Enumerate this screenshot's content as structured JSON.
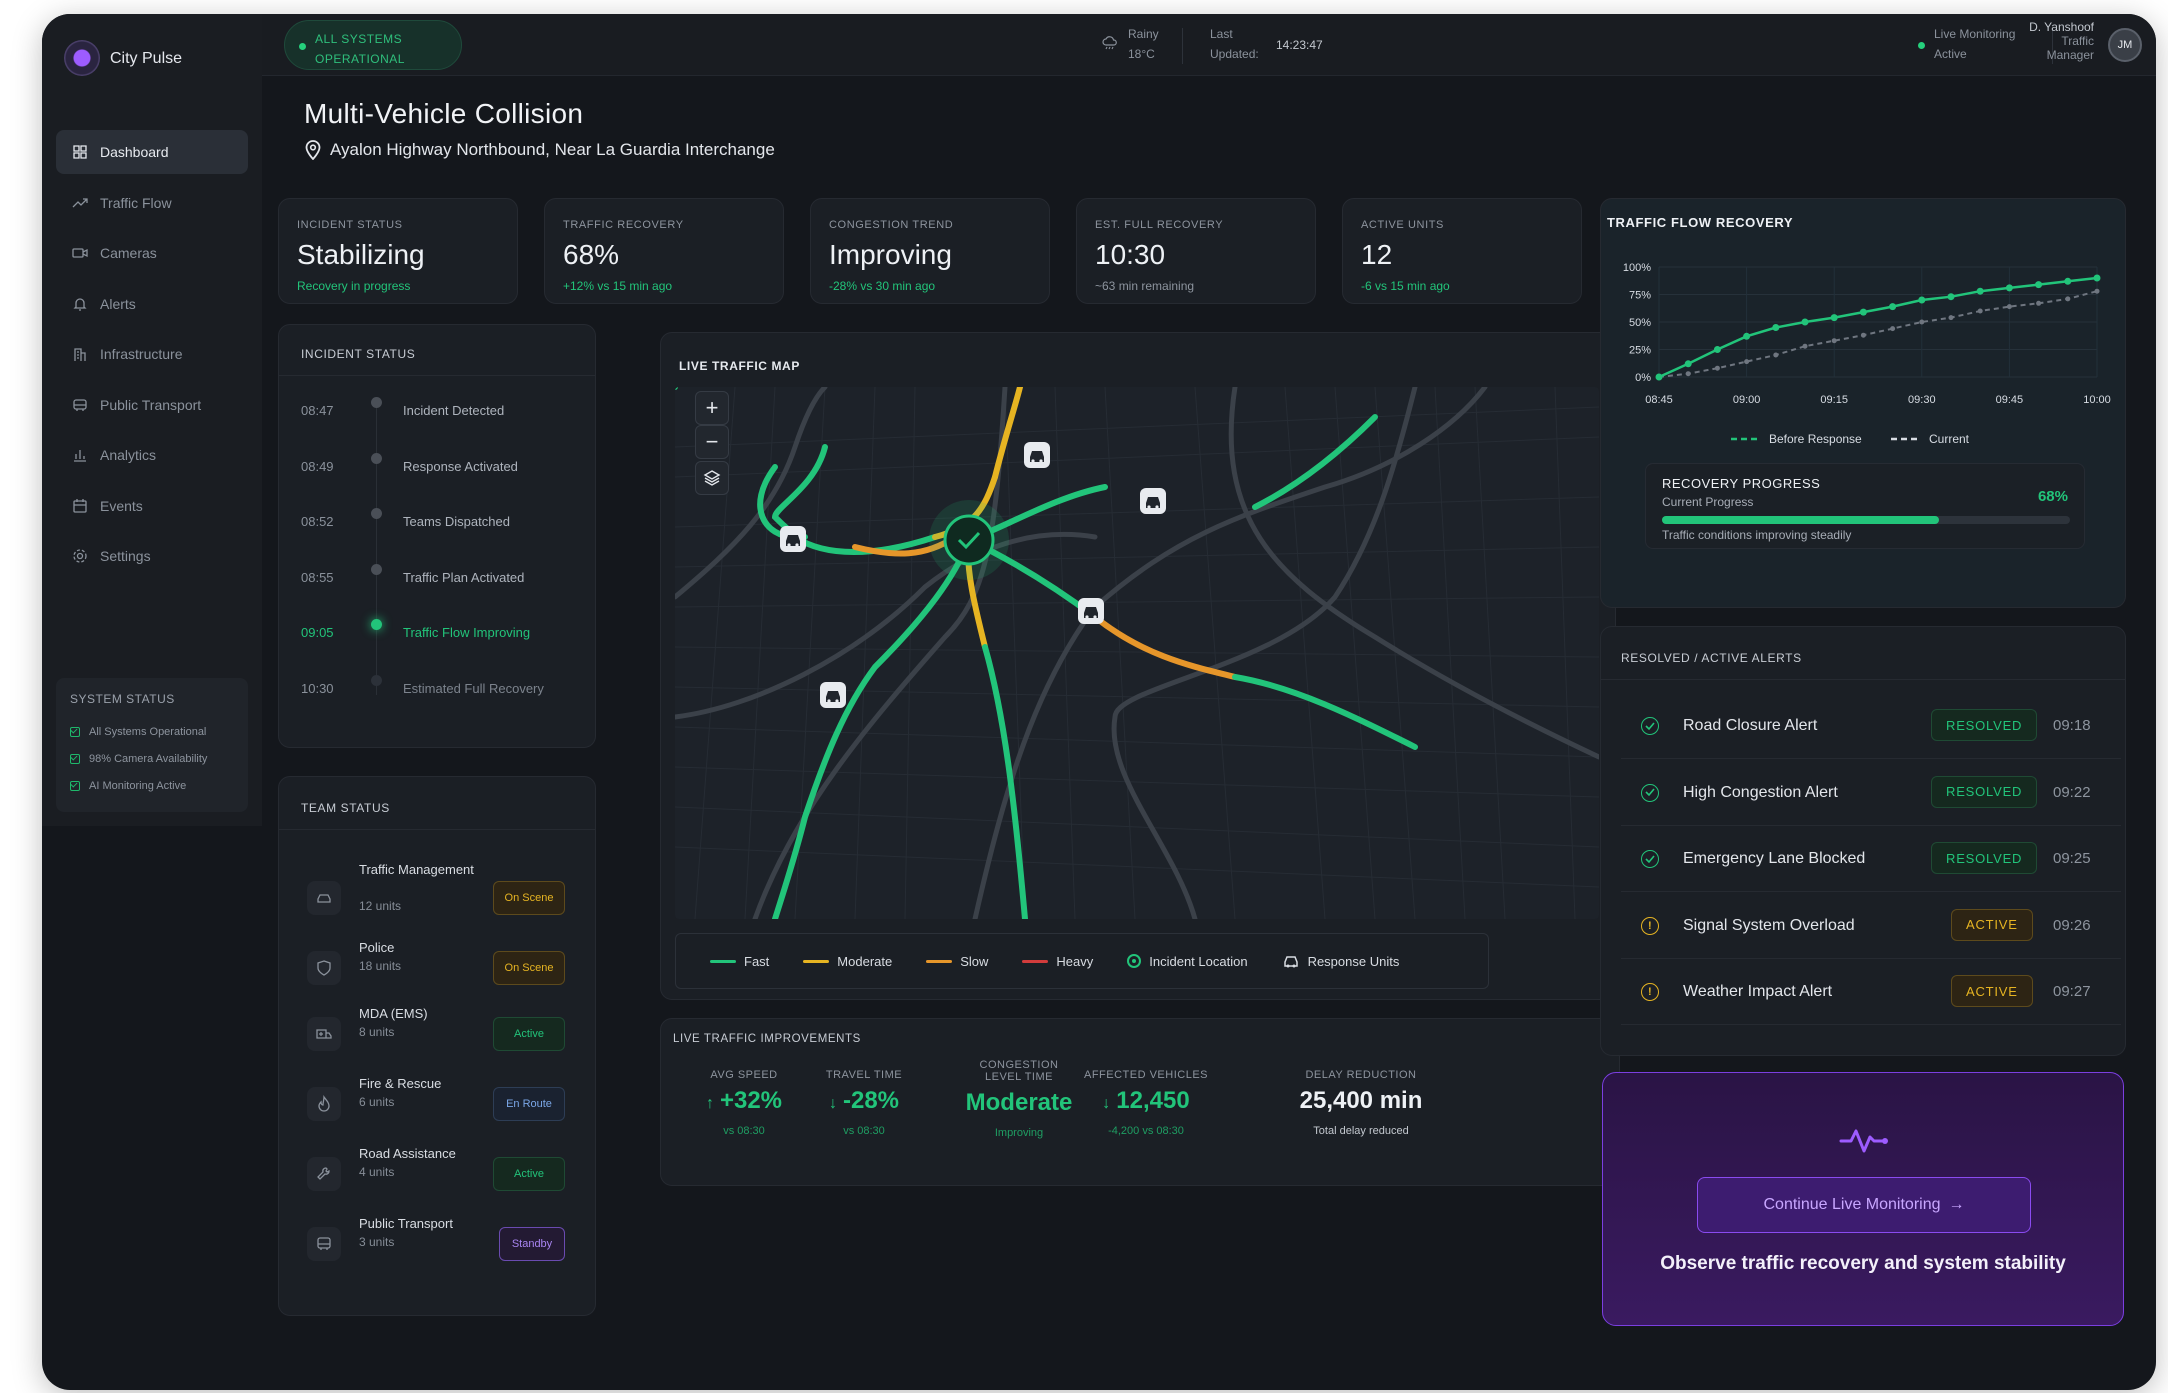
{
  "brand": {
    "name": "City Pulse"
  },
  "sidebar": {
    "items": [
      {
        "label": "Dashboard",
        "icon": "grid-icon",
        "active": true
      },
      {
        "label": "Traffic Flow",
        "icon": "trend-icon"
      },
      {
        "label": "Cameras",
        "icon": "camera-icon"
      },
      {
        "label": "Alerts",
        "icon": "bell-icon"
      },
      {
        "label": "Infrastructure",
        "icon": "building-icon"
      },
      {
        "label": "Public Transport",
        "icon": "bus-icon"
      },
      {
        "label": "Analytics",
        "icon": "bar-chart-icon"
      },
      {
        "label": "Events",
        "icon": "calendar-icon"
      },
      {
        "label": "Settings",
        "icon": "gear-icon"
      }
    ],
    "system_status": {
      "title": "SYSTEM STATUS",
      "rows": [
        "All Systems Operational",
        "98% Camera Availability",
        "AI Monitoring Active"
      ]
    }
  },
  "topbar": {
    "status_line1": "ALL SYSTEMS",
    "status_line2": "OPERATIONAL",
    "weather_cond": "Rainy",
    "weather_temp": "18°C",
    "updated_line1": "Last",
    "updated_line2": "Updated:",
    "updated_time": "14:23:47",
    "live_line1": "Live Monitoring",
    "live_line2": "Active",
    "user_name": "D. Yanshoof",
    "user_role1": "Traffic",
    "user_role2": "Manager",
    "user_initials": "JM"
  },
  "header": {
    "title": "Multi-Vehicle Collision",
    "location": "Ayalon Highway Northbound, Near La Guardia Interchange"
  },
  "kpis": [
    {
      "label": "INCIDENT STATUS",
      "value": "Stabilizing",
      "sub": "Recovery in progress",
      "sub_tone": "green"
    },
    {
      "label": "TRAFFIC RECOVERY",
      "value": "68%",
      "sub": "+12% vs 15 min ago",
      "sub_tone": "green"
    },
    {
      "label": "CONGESTION TREND",
      "value": "Improving",
      "sub": "-28% vs 30 min ago",
      "sub_tone": "green"
    },
    {
      "label": "EST. FULL RECOVERY",
      "value": "10:30",
      "sub": "~63 min remaining",
      "sub_tone": "muted"
    },
    {
      "label": "ACTIVE UNITS",
      "value": "12",
      "sub": "-6 vs 15 min ago",
      "sub_tone": "green"
    }
  ],
  "timeline": {
    "title": "INCIDENT STATUS",
    "items": [
      {
        "time": "08:47",
        "label": "Incident Detected"
      },
      {
        "time": "08:49",
        "label": "Response Activated"
      },
      {
        "time": "08:52",
        "label": "Teams Dispatched"
      },
      {
        "time": "08:55",
        "label": "Traffic Plan Activated"
      },
      {
        "time": "09:05",
        "label": "Traffic Flow Improving",
        "current": true
      },
      {
        "time": "10:30",
        "label": "Estimated Full Recovery",
        "future": true
      }
    ]
  },
  "team": {
    "title": "TEAM STATUS",
    "items": [
      {
        "name": "Traffic Management",
        "units": "12 units",
        "status": "On Scene",
        "tone": "amber",
        "icon": "car-icon"
      },
      {
        "name": "Police",
        "units": "18 units",
        "status": "On Scene",
        "tone": "amber",
        "icon": "shield-icon"
      },
      {
        "name": "MDA (EMS)",
        "units": "8 units",
        "status": "Active",
        "tone": "green",
        "icon": "ambulance-icon"
      },
      {
        "name": "Fire & Rescue",
        "units": "6 units",
        "status": "En Route",
        "tone": "blue",
        "icon": "flame-icon"
      },
      {
        "name": "Road Assistance",
        "units": "4 units",
        "status": "Active",
        "tone": "green",
        "icon": "wrench-icon"
      },
      {
        "name": "Public Transport",
        "units": "3 units",
        "status": "Standby",
        "tone": "purple",
        "icon": "bus-icon"
      }
    ]
  },
  "map": {
    "title": "LIVE TRAFFIC MAP",
    "legend": [
      {
        "label": "Fast",
        "color": "#22c47a"
      },
      {
        "label": "Moderate",
        "color": "#e6b422"
      },
      {
        "label": "Slow",
        "color": "#e6962a"
      },
      {
        "label": "Heavy",
        "color": "#d23c3c"
      },
      {
        "label": "Incident Location",
        "color": "#22c47a"
      },
      {
        "label": "Response Units",
        "color": "#d8dce2"
      }
    ]
  },
  "improvements": {
    "title": "LIVE TRAFFIC IMPROVEMENTS",
    "items": [
      {
        "label": "AVG SPEED",
        "value": "+32%",
        "arrow": "↑",
        "sub": "vs 08:30"
      },
      {
        "label": "TRAVEL TIME",
        "value": "-28%",
        "arrow": "↓",
        "sub": "vs 08:30"
      },
      {
        "label1": "CONGESTION",
        "label2": "LEVEL TIME",
        "value": "Moderate",
        "sub": "Improving"
      },
      {
        "label": "AFFECTED VEHICLES",
        "value": "12,450",
        "arrow": "↓",
        "sub": "-4,200 vs 08:30"
      },
      {
        "label": "DELAY REDUCTION",
        "value": "25,400 min",
        "sub": "Total delay reduced"
      }
    ]
  },
  "recovery_chart": {
    "title": "TRAFFIC FLOW RECOVERY",
    "progress_title": "RECOVERY PROGRESS",
    "progress_sub": "Current Progress",
    "progress_value": "68%",
    "progress_fraction": 0.68,
    "progress_note": "Traffic conditions improving steadily"
  },
  "chart_data": {
    "type": "line",
    "title": "TRAFFIC FLOW RECOVERY",
    "x": [
      "08:45",
      "08:50",
      "08:55",
      "09:00",
      "09:05",
      "09:10",
      "09:15",
      "09:20",
      "09:25",
      "09:30",
      "09:35",
      "09:40",
      "09:45",
      "09:50",
      "09:55",
      "10:00"
    ],
    "x_ticks": [
      "08:45",
      "09:00",
      "09:15",
      "09:30",
      "09:45",
      "10:00"
    ],
    "y_ticks": [
      "0%",
      "25%",
      "50%",
      "75%",
      "100%"
    ],
    "ylim": [
      0,
      100
    ],
    "series": [
      {
        "name": "Before Response",
        "color": "#22c47a",
        "style": "solid",
        "values": [
          0,
          12,
          25,
          37,
          45,
          50,
          54,
          59,
          64,
          70,
          73,
          78,
          81,
          84,
          87,
          90
        ]
      },
      {
        "name": "Current",
        "color": "#6f7680",
        "style": "dashed",
        "values": null,
        "values_partial": [
          [
            1,
            3
          ],
          [
            2,
            8
          ],
          [
            3,
            14
          ],
          [
            4,
            20
          ],
          [
            5,
            28
          ],
          [
            6,
            33
          ],
          [
            7,
            38
          ],
          [
            8,
            44
          ],
          [
            9,
            50
          ],
          [
            10,
            54
          ],
          [
            11,
            60
          ],
          [
            12,
            64
          ],
          [
            13,
            67
          ],
          [
            14,
            71
          ],
          [
            15,
            78
          ]
        ]
      }
    ],
    "legend_position": "bottom",
    "grid": true
  },
  "alerts": {
    "title": "RESOLVED / ACTIVE ALERTS",
    "items": [
      {
        "name": "Road Closure Alert",
        "status": "RESOLVED",
        "time": "09:18"
      },
      {
        "name": "High Congestion Alert",
        "status": "RESOLVED",
        "time": "09:22"
      },
      {
        "name": "Emergency Lane Blocked",
        "status": "RESOLVED",
        "time": "09:25"
      },
      {
        "name": "Signal System Overload",
        "status": "ACTIVE",
        "time": "09:26"
      },
      {
        "name": "Weather Impact Alert",
        "status": "ACTIVE",
        "time": "09:27"
      }
    ]
  },
  "cta": {
    "button": "Continue Live Monitoring",
    "text": "Observe traffic recovery and system stability"
  }
}
